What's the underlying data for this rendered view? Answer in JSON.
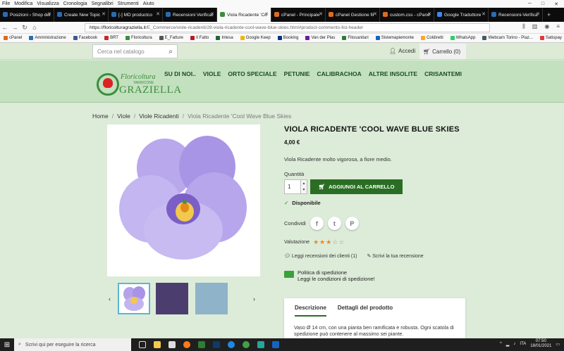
{
  "menubar": {
    "items": [
      "File",
      "Modifica",
      "Visualizza",
      "Cronologia",
      "Segnalibri",
      "Strumenti",
      "Aiuto"
    ]
  },
  "tabs": [
    {
      "label": "Posizioni › Shop del"
    },
    {
      "label": "Create New Topic"
    },
    {
      "label": "[-] MD productco"
    },
    {
      "label": "Recensioni Verificat"
    },
    {
      "label": "Viola Ricadente 'Co"
    },
    {
      "label": "cPanel - Principale"
    },
    {
      "label": "cPanel Gestione fil"
    },
    {
      "label": "custom.css - cPane"
    },
    {
      "label": "Google Traduttore"
    },
    {
      "label": "Recensioni-Verifica"
    }
  ],
  "url": {
    "host": "https://floricolturagraziella.it",
    "path": "/E_Commerce/viole-ricadenti/28-viola-ricadente-cool-wave-blue-skies.html#product-comments-list-header"
  },
  "bookmarks": [
    {
      "label": "cPanel",
      "color": "#e06b1f"
    },
    {
      "label": "Amministrazione",
      "color": "#2b6cb0"
    },
    {
      "label": "Facebook",
      "color": "#3b5998"
    },
    {
      "label": "BRT",
      "color": "#c62828"
    },
    {
      "label": "Floricoltura",
      "color": "#3a8e3c"
    },
    {
      "label": "E_Fatture",
      "color": "#555"
    },
    {
      "label": "Il Fatto",
      "color": "#b71c1c"
    },
    {
      "label": "Intesa",
      "color": "#1e6b2e"
    },
    {
      "label": "Google Keep",
      "color": "#f2b600"
    },
    {
      "label": "Booking",
      "color": "#003580"
    },
    {
      "label": "Van der Plas",
      "color": "#6a1b9a"
    },
    {
      "label": "Fitosanitari",
      "color": "#2e7d32"
    },
    {
      "label": "Sistemapiemonte",
      "color": "#1565c0"
    },
    {
      "label": "Coldiretti",
      "color": "#f9a825"
    },
    {
      "label": "WhatsApp",
      "color": "#25d366"
    },
    {
      "label": "Webcam Torino - Piaz...",
      "color": "#455a64"
    },
    {
      "label": "Satispay",
      "color": "#e53935"
    }
  ],
  "shop": {
    "search_placeholder": "Cerca nel catalogo",
    "login": "Accedi",
    "cart": "Carrello (0)",
    "logo": {
      "line1": "Floricoltura",
      "line2": "TARRICONE",
      "line3": "GRAZIELLA"
    },
    "menu": [
      "SU DI NOI..",
      "VIOLE",
      "ORTO SPECIALE",
      "PETUNIE",
      "CALIBRACHOA",
      "ALTRE INSOLITE",
      "CRISANTEMI"
    ],
    "breadcrumb": [
      "Home",
      "Viole",
      "Viole Ricadenti",
      "Viola Ricadente 'Cool Wave Blue Skies"
    ]
  },
  "product": {
    "title": "VIOLA RICADENTE 'COOL WAVE BLUE SKIES",
    "price": "4,00 €",
    "description": "Viola Ricadente molto vigorosa, a fiore medio.",
    "quantity_label": "Quantità",
    "quantity": "1",
    "add_to_cart": "AGGIUNGI AL CARRELLO",
    "availability": "Disponibile",
    "share_label": "Condividi",
    "rating_label": "Valutazione",
    "rating": 3,
    "rating_max": 5,
    "read_reviews": "Leggi recensioni dei clienti (1)",
    "write_review": "Scrivi la tua recensione",
    "shipping_title": "Politica di spedizione",
    "shipping_link": "Leggi le condizioni di spedizione!",
    "tabs": [
      "Descrizione",
      "Dettagli del prodotto"
    ],
    "tab_text": "Vaso Ø 14 cm, con una pianta ben ramificata e robusta. Ogni scatola di spedizione può contenere al massimo sei piante."
  },
  "taskbar": {
    "search_placeholder": "Scrivi qui per eseguire la ricerca",
    "time": "07:50",
    "date": "18/01/2021",
    "lang": "ITA"
  },
  "colors": {
    "accent": "#2a6e24",
    "header": "#c3e0bf",
    "page": "#ddebd9",
    "star": "#e88a22"
  }
}
